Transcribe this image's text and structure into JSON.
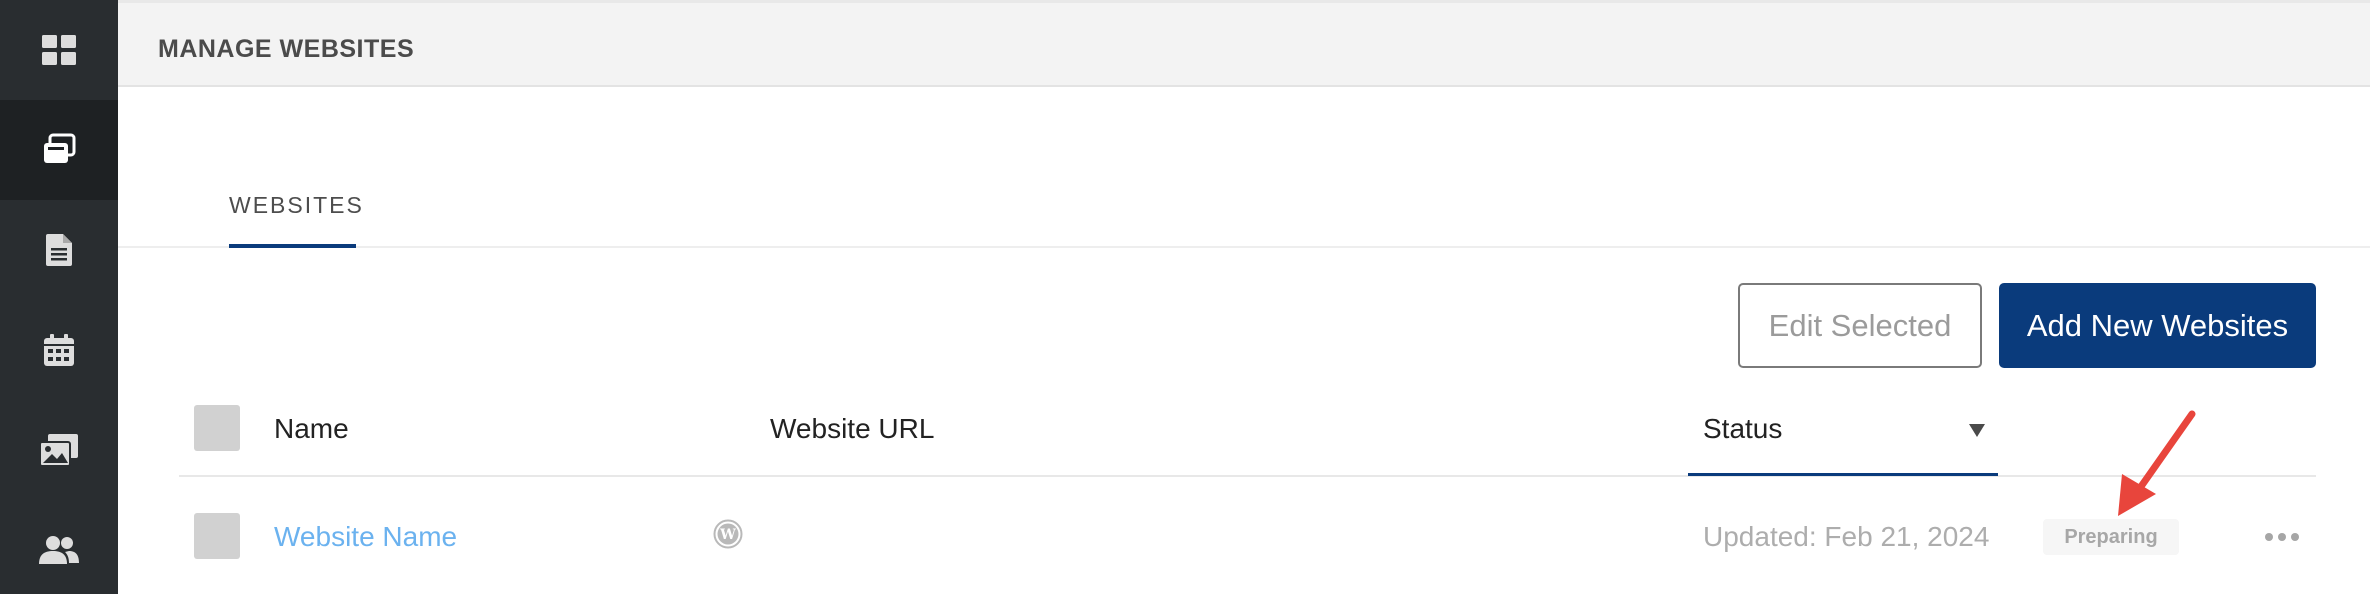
{
  "sidebar": {
    "items": [
      {
        "icon": "dashboard-grid-icon",
        "active": false
      },
      {
        "icon": "websites-stack-icon",
        "active": true
      },
      {
        "icon": "document-icon",
        "active": false
      },
      {
        "icon": "calendar-icon",
        "active": false
      },
      {
        "icon": "media-gallery-icon",
        "active": false
      },
      {
        "icon": "users-icon",
        "active": false
      }
    ]
  },
  "header": {
    "title": "MANAGE WEBSITES"
  },
  "tabs": [
    {
      "label": "WEBSITES",
      "active": true
    }
  ],
  "toolbar": {
    "edit_label": "Edit Selected",
    "add_label": "Add New Websites"
  },
  "table": {
    "columns": {
      "name": "Name",
      "url": "Website URL",
      "status": "Status"
    },
    "rows": [
      {
        "name": "Website Name",
        "platform_icon": "wordpress-icon",
        "updated": "Updated: Feb 21, 2024",
        "status": "Preparing"
      }
    ]
  },
  "colors": {
    "accent": "#0a3b7c",
    "link": "#6bb2ef",
    "sidebar": "#292d30",
    "annotation": "#e8453c"
  }
}
